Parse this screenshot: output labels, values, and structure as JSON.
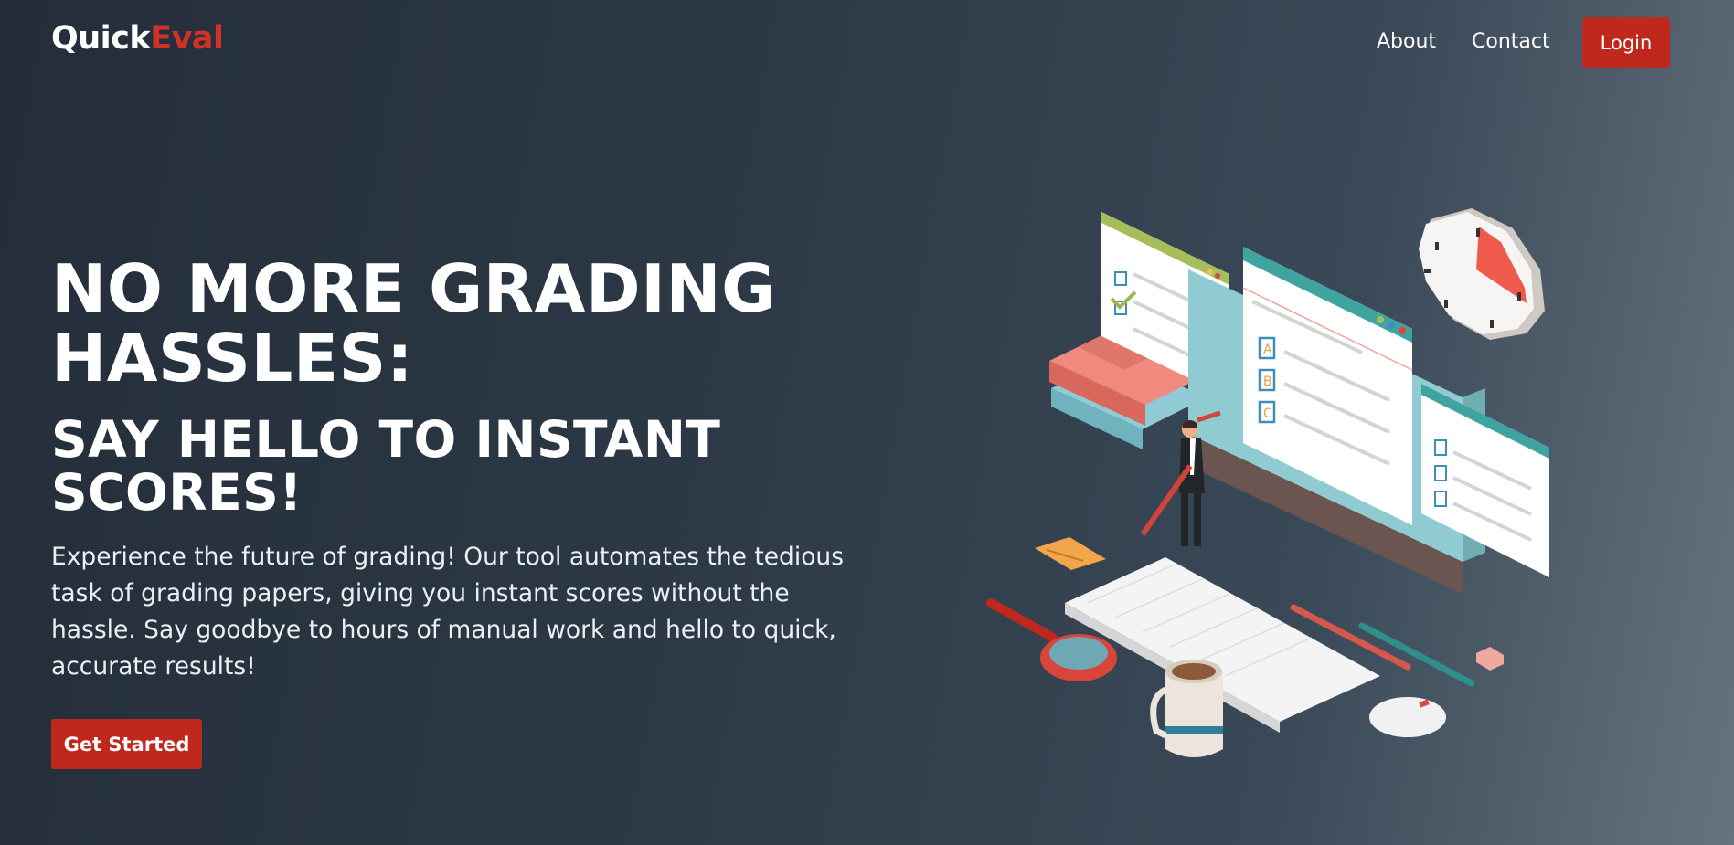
{
  "brand": {
    "part1": "Quick",
    "part2": "Eval"
  },
  "nav": {
    "about": "About",
    "contact": "Contact",
    "login": "Login"
  },
  "hero": {
    "title_line1": "NO MORE GRADING",
    "title_line2": "HASSLES:",
    "subtitle_line1": "SAY HELLO TO INSTANT",
    "subtitle_line2": "SCORES!",
    "description": "Experience the future of grading! Our tool automates the tedious task of grading papers, giving you instant scores without the hassle. Say goodbye to hours of manual work and hello to quick, accurate results!",
    "cta": "Get Started"
  },
  "illustration": {
    "answer_options": [
      "A",
      "B",
      "C"
    ]
  },
  "colors": {
    "accent": "#c0281e",
    "logo_accent": "#d03226",
    "background_dark": "#242e3a",
    "background_light": "#66737f"
  }
}
